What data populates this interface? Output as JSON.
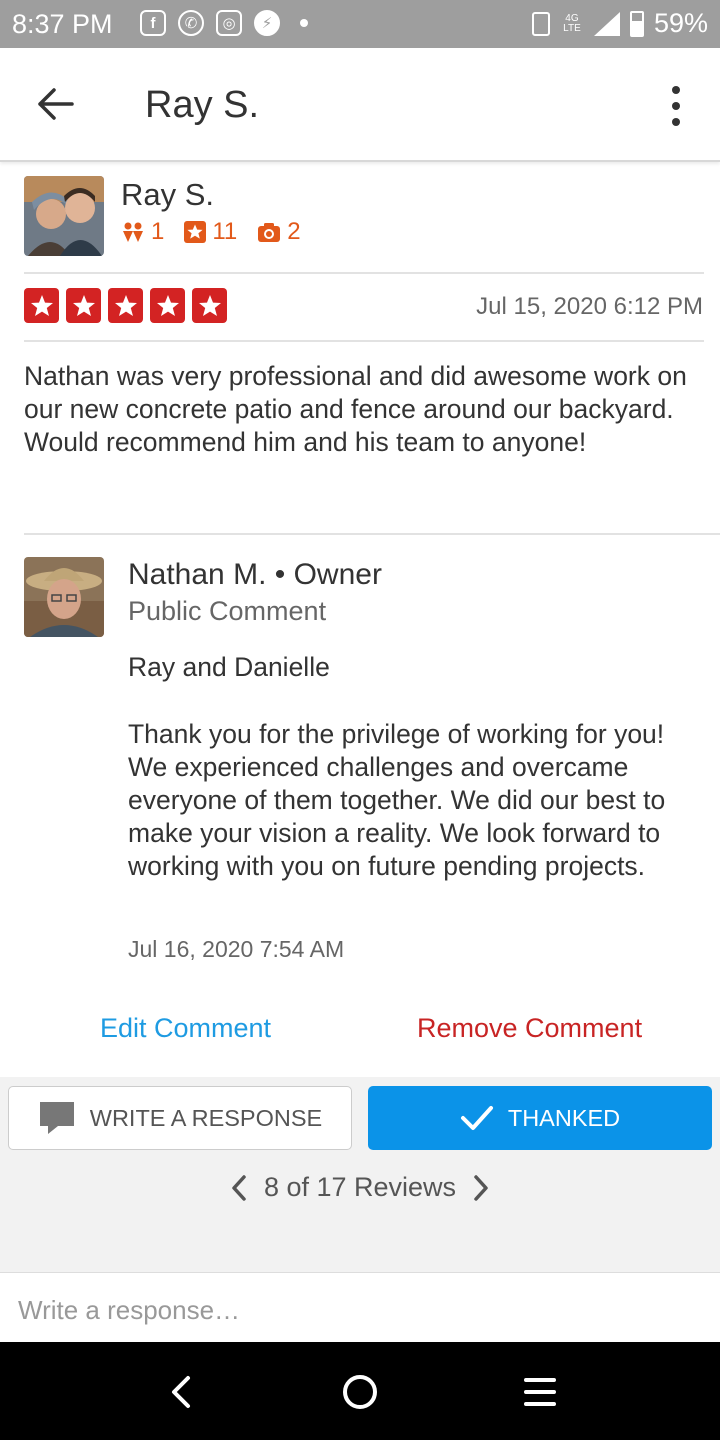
{
  "status_bar": {
    "time": "8:37 PM",
    "network": "4G LTE",
    "battery": "59%"
  },
  "app_bar": {
    "title": "Ray S."
  },
  "review": {
    "author": "Ray S.",
    "stats": {
      "friends": "1",
      "reviews": "11",
      "photos": "2"
    },
    "rating": 5,
    "date": "Jul 15, 2020 6:12 PM",
    "text": "Nathan was very professional and did awesome work on our new concrete patio and fence around our backyard. Would recommend him and his team to anyone!"
  },
  "owner_comment": {
    "name": "Nathan M. • Owner",
    "type": "Public Comment",
    "greeting": "Ray and Danielle",
    "body": "Thank you for the privilege of working for you! We experienced challenges and overcame everyone of them together.  We did our best to make your vision a reality.  We look forward to working with you on future pending projects.",
    "date": "Jul 16, 2020 7:54 AM",
    "edit_label": "Edit Comment",
    "remove_label": "Remove Comment"
  },
  "actions": {
    "respond_label": "WRITE A RESPONSE",
    "thanked_label": "THANKED"
  },
  "pager": {
    "label": "8 of 17 Reviews"
  },
  "response_input": {
    "placeholder": "Write a response…"
  },
  "colors": {
    "star_red": "#d32323",
    "link_blue": "#1e9be2",
    "remove_red": "#c82424",
    "thanked_blue": "#0b93e8",
    "stat_orange": "#e2591a"
  }
}
